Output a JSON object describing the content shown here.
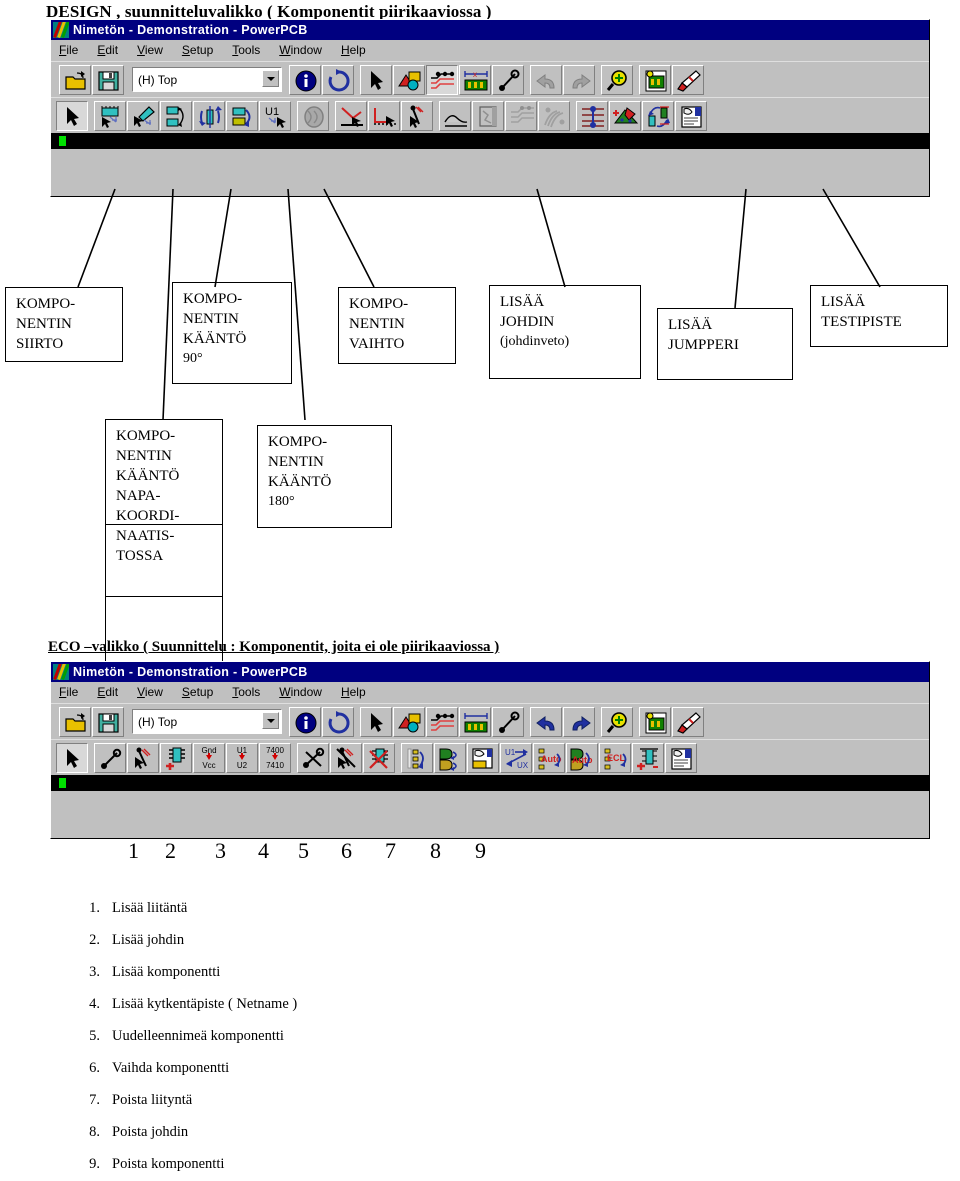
{
  "doc": {
    "title": "DESIGN , suunnitteluvalikko ( Komponentit piirikaaviossa )",
    "eco_title": "ECO –valikko ( Suunnittelu : Komponentit,  joita ei ole piirikaaviossa )"
  },
  "window": {
    "title": "Nimetön - Demonstration - PowerPCB",
    "menu": [
      "File",
      "Edit",
      "View",
      "Setup",
      "Tools",
      "Window",
      "Help"
    ],
    "layer_combo": {
      "value": "(H) Top",
      "placeholder": "(H) Top"
    }
  },
  "toolbar_standard": [
    {
      "name": "open-file",
      "icon": "folder-open-icon"
    },
    {
      "name": "save-file",
      "icon": "floppy-disk-icon"
    },
    {
      "name": "layer-combo",
      "icon": "combo-box"
    },
    {
      "name": "query-info",
      "icon": "info-icon"
    },
    {
      "name": "refresh-view",
      "icon": "refresh-icon"
    },
    {
      "name": "select-tool",
      "icon": "arrow-pointer-icon"
    },
    {
      "name": "design-rules",
      "icon": "design-rules-icon"
    },
    {
      "name": "route-mode",
      "icon": "route-traces-icon"
    },
    {
      "name": "board-outline",
      "icon": "board-dimension-icon"
    },
    {
      "name": "measure-tool",
      "icon": "measure-line-icon"
    },
    {
      "name": "undo",
      "icon": "undo-arrow-icon"
    },
    {
      "name": "redo",
      "icon": "redo-arrow-icon"
    },
    {
      "name": "zoom-in",
      "icon": "magnifier-plus-icon"
    },
    {
      "name": "zoom-board",
      "icon": "zoom-board-icon"
    },
    {
      "name": "paint-tool",
      "icon": "paint-brush-icon"
    }
  ],
  "toolbar_design": [
    {
      "name": "select-tool",
      "icon": "arrow-pointer-icon",
      "pressed": true
    },
    {
      "name": "move-component",
      "icon": "move-component-icon"
    },
    {
      "name": "glue-component",
      "icon": "glue-component-icon"
    },
    {
      "name": "rotate-90",
      "icon": "rotate-90-icon"
    },
    {
      "name": "rotate-polar",
      "icon": "rotate-polar-icon"
    },
    {
      "name": "rotate-180",
      "icon": "rotate-180-icon"
    },
    {
      "name": "swap-component",
      "icon": "swap-component-icon"
    },
    {
      "name": "pin-swap",
      "icon": "pin-swap-icon"
    },
    {
      "name": "add-route",
      "icon": "add-route-icon"
    },
    {
      "name": "add-corner",
      "icon": "add-corner-icon"
    },
    {
      "name": "add-jumper",
      "icon": "add-jumper-icon"
    },
    {
      "name": "split-plane",
      "icon": "split-plane-icon"
    },
    {
      "name": "copper-pour",
      "icon": "copper-pour-icon"
    },
    {
      "name": "fanout",
      "icon": "fanout-icon"
    },
    {
      "name": "bus-route",
      "icon": "bus-route-icon"
    },
    {
      "name": "add-testpoint",
      "icon": "add-testpoint-icon"
    },
    {
      "name": "add-plane",
      "icon": "add-plane-icon"
    },
    {
      "name": "exchange-pins",
      "icon": "exchange-pins-icon"
    },
    {
      "name": "report",
      "icon": "report-icon"
    }
  ],
  "toolbar_eco": [
    {
      "name": "select-tool",
      "icon": "arrow-pointer-icon",
      "pressed": true
    },
    {
      "name": "add-connection",
      "icon": "add-connection-icon"
    },
    {
      "name": "add-netname",
      "icon": "add-netname-icon"
    },
    {
      "name": "add-component",
      "icon": "add-component-icon"
    },
    {
      "name": "rename-net",
      "icon": "gnd-vcc-icon",
      "label_top": "Gnd",
      "label_bottom": "Vcc"
    },
    {
      "name": "rename-component",
      "icon": "u1-u2-icon",
      "label_top": "U1",
      "label_bottom": "U2"
    },
    {
      "name": "swap-part-type",
      "icon": "7400-7410-icon",
      "label_top": "7400",
      "label_bottom": "7410"
    },
    {
      "name": "delete-connection",
      "icon": "delete-connection-icon"
    },
    {
      "name": "delete-netname",
      "icon": "delete-netname-icon"
    },
    {
      "name": "delete-component",
      "icon": "delete-component-icon"
    },
    {
      "name": "swap-pins",
      "icon": "swap-pins-icon"
    },
    {
      "name": "swap-gates",
      "icon": "swap-gates-icon"
    },
    {
      "name": "measure",
      "icon": "hand-report-icon"
    },
    {
      "name": "rename-u1-ux",
      "icon": "u1-ux-icon"
    },
    {
      "name": "auto-rename-pins",
      "icon": "auto-pins-icon"
    },
    {
      "name": "auto-rename-gates",
      "icon": "auto-gates-icon"
    },
    {
      "name": "ecl-swap",
      "icon": "ecl-icon"
    },
    {
      "name": "add-part",
      "icon": "add-part-icon"
    },
    {
      "name": "eco-report",
      "icon": "eco-report-icon"
    }
  ],
  "callouts": [
    {
      "id": "komponentin-siirto",
      "lines": [
        "KOMPO-",
        "NENTIN",
        "SIIRTO"
      ]
    },
    {
      "id": "komponentin-kaanto-90",
      "lines": [
        "KOMPO-",
        "NENTIN",
        "KÄÄNTÖ",
        "90°"
      ]
    },
    {
      "id": "komponentin-vaihto",
      "lines": [
        "KOMPO-",
        "NENTIN",
        "VAIHTO"
      ]
    },
    {
      "id": "lisaa-johdin",
      "lines": [
        "LISÄÄ",
        "JOHDIN",
        "(johdinveto)"
      ]
    },
    {
      "id": "lisaa-jumpperi",
      "lines": [
        "LISÄÄ",
        "JUMPPERI"
      ]
    },
    {
      "id": "lisaa-testipiste",
      "lines": [
        "LISÄÄ",
        "TESTIPISTE"
      ]
    },
    {
      "id": "komponentin-kaanto-napakoordinaatistossa",
      "lines": [
        "KOMPO-",
        "NENTIN",
        "KÄÄNTÖ",
        "NAPA-",
        "KOORDI-",
        "NAATIS-",
        "TOSSA"
      ]
    },
    {
      "id": "komponentin-kaanto-180",
      "lines": [
        "KOMPO-",
        "NENTIN",
        "KÄÄNTÖ",
        "180°"
      ]
    }
  ],
  "numbers_row": [
    "1",
    "2",
    "3",
    "4",
    "5",
    "6",
    "7",
    "8",
    "9"
  ],
  "eco_list": [
    {
      "num": "1.",
      "text": "Lisää liitäntä"
    },
    {
      "num": "2.",
      "text": "Lisää johdin"
    },
    {
      "num": "3.",
      "text": "Lisää komponentti"
    },
    {
      "num": "4.",
      "text": "Lisää kytkentäpiste ( Netname )"
    },
    {
      "num": "5.",
      "text": "Uudelleennimeä komponentti"
    },
    {
      "num": "6.",
      "text": "Vaihda komponentti"
    },
    {
      "num": "7.",
      "text": "Poista liityntä"
    },
    {
      "num": "8.",
      "text": "Poista johdin"
    },
    {
      "num": "9.",
      "text": "Poista komponentti"
    }
  ],
  "colors": {
    "titlebar": "#000080",
    "face": "#c0c0c0",
    "statusbar": "#000000",
    "led": "#00e000",
    "text": "#000000"
  }
}
